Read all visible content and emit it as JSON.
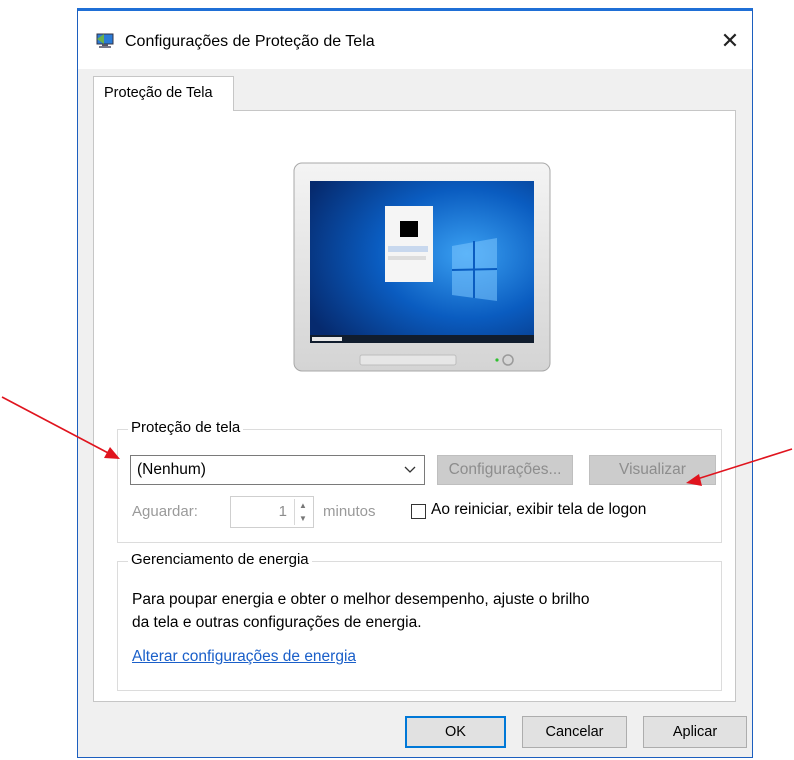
{
  "window": {
    "title": "Configurações de Proteção de Tela",
    "close_glyph": "✕",
    "icon": "screen-saver-app-icon"
  },
  "tabs": [
    {
      "label": "Proteção de Tela",
      "active": true
    }
  ],
  "preview": {
    "icon": "monitor-preview-image"
  },
  "screensaver_group": {
    "label": "Proteção de tela",
    "selected": "(Nenhum)",
    "settings_label": "Configurações...",
    "preview_label": "Visualizar",
    "wait_label": "Aguardar:",
    "wait_value": "1",
    "minutes_label": "minutos",
    "logon_checkbox_label": "Ao reiniciar, exibir tela de logon",
    "logon_checked": false
  },
  "power_group": {
    "label": "Gerenciamento de energia",
    "text_line1": "Para poupar energia e obter o melhor desempenho, ajuste o brilho",
    "text_line2": "da tela e outras configurações de energia.",
    "link": "Alterar configurações de energia"
  },
  "buttons": {
    "ok": "OK",
    "cancel": "Cancelar",
    "apply": "Aplicar"
  },
  "annotations": {
    "arrow_color": "#e0141e"
  },
  "colors": {
    "accent": "#0078d7",
    "link": "#1a5fc9"
  }
}
